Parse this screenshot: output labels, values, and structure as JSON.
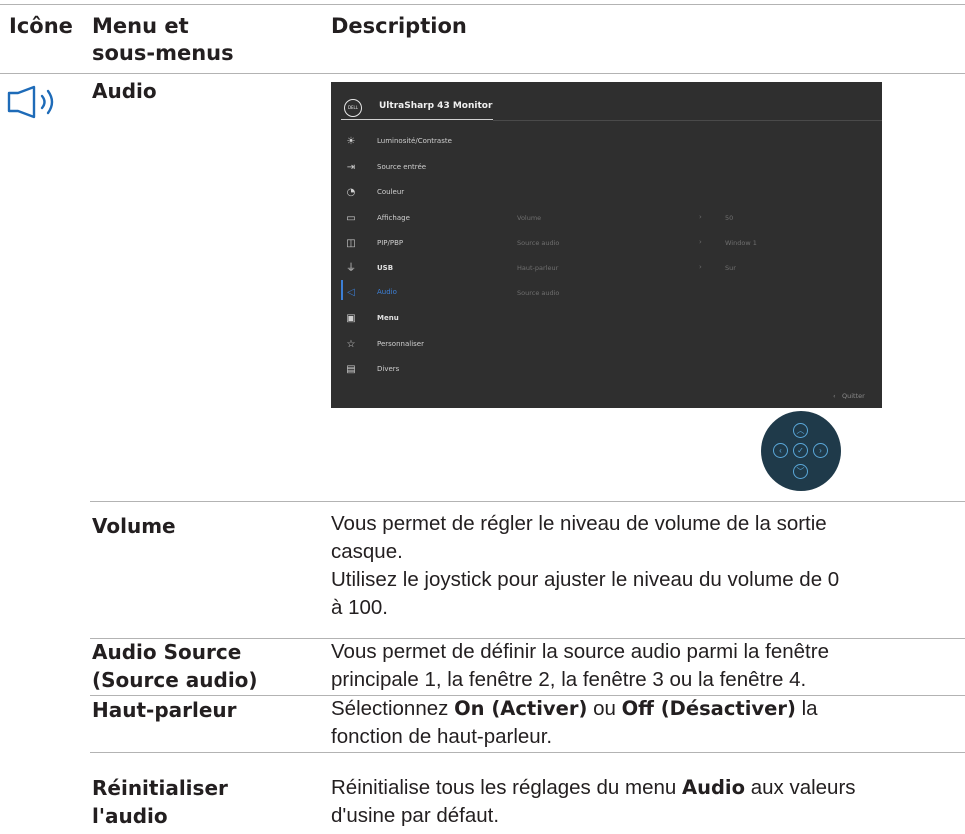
{
  "header": {
    "col1": "Icône",
    "col2_line1": "Menu et",
    "col2_line2": "sous-menus",
    "col3": "Description"
  },
  "section": {
    "icon": "speaker-icon",
    "title": "Audio"
  },
  "osd": {
    "logo_text": "DELL",
    "title": "UltraSharp 43 Monitor",
    "menu": [
      {
        "icon": "brightness-icon",
        "label": "Luminosité/Contraste"
      },
      {
        "icon": "input-source-icon",
        "label": "Source entrée"
      },
      {
        "icon": "color-icon",
        "label": "Couleur"
      },
      {
        "icon": "display-icon",
        "label": "Affichage"
      },
      {
        "icon": "pip-pbp-icon",
        "label": "PIP/PBP"
      },
      {
        "icon": "usb-icon",
        "label": "USB"
      },
      {
        "icon": "audio-icon",
        "label": "Audio"
      },
      {
        "icon": "menu-icon",
        "label": "Menu"
      },
      {
        "icon": "star-icon",
        "label": "Personnaliser"
      },
      {
        "icon": "others-icon",
        "label": "Divers"
      }
    ],
    "submenu": [
      {
        "label": "Volume",
        "value": "50"
      },
      {
        "label": "Source audio",
        "value": "Window 1"
      },
      {
        "label": "Haut-parleur",
        "value": "Sur"
      },
      {
        "label": "Source audio",
        "value": ""
      }
    ],
    "quit": "Quitter",
    "accent": "#3c7fd6"
  },
  "rows": [
    {
      "label": [
        "Volume"
      ],
      "desc": [
        "Vous permet de régler le niveau de volume de la sortie",
        "casque.",
        "Utilisez le joystick pour ajuster le niveau du volume de 0",
        "à 100."
      ]
    },
    {
      "label": [
        "Audio Source",
        "(Source audio)"
      ],
      "desc": [
        "Vous permet de définir la source audio parmi la fenêtre",
        "principale 1, la fenêtre 2, la fenêtre 3 ou la fenêtre 4."
      ]
    },
    {
      "label": [
        "Haut-parleur"
      ],
      "desc_pre": "Sélectionnez ",
      "desc_b1": "On (Activer)",
      "desc_mid": " ou ",
      "desc_b2": "Off (Désactiver)",
      "desc_post": " la",
      "desc_line2": "fonction de haut-parleur."
    },
    {
      "label": [
        "Réinitialiser",
        "l'audio"
      ],
      "desc_pre": "Réinitialise tous les réglages du menu ",
      "desc_b1": "Audio",
      "desc_post": " aux valeurs",
      "desc_line2": "d'usine par défaut."
    }
  ]
}
